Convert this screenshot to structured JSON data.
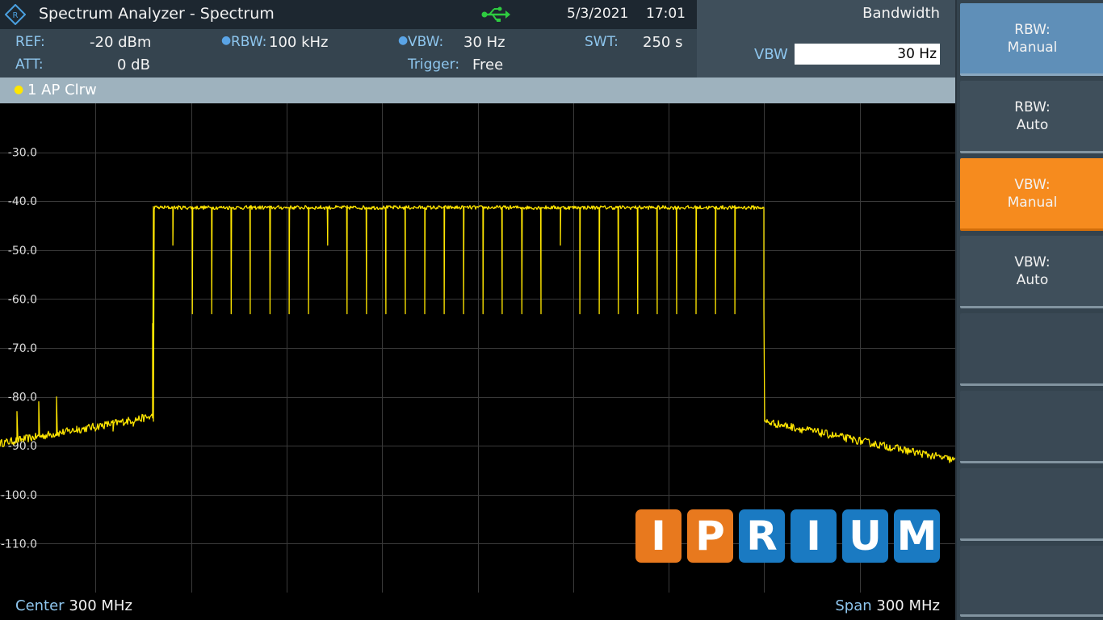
{
  "titlebar": {
    "title": "Spectrum Analyzer - Spectrum",
    "date": "5/3/2021",
    "time": "17:01"
  },
  "params": {
    "ref_label": "REF:",
    "ref_value": "-20 dBm",
    "att_label": "ATT:",
    "att_value": "0 dB",
    "rbw_label": "RBW:",
    "rbw_value": "100 kHz",
    "vbw_label": "VBW:",
    "vbw_value": "30 Hz",
    "trigger_label": "Trigger:",
    "trigger_value": "Free",
    "swt_label": "SWT:",
    "swt_value": "250 s"
  },
  "menu": {
    "title": "Bandwidth",
    "vbw_label": "VBW",
    "vbw_input": "30 Hz"
  },
  "trace": {
    "label": "1 AP  Clrw",
    "color": "#ffe600"
  },
  "footer": {
    "center_label": "Center",
    "center_value": "300 MHz",
    "span_label": "Span",
    "span_value": "300 MHz"
  },
  "softkeys": [
    {
      "line1": "RBW:",
      "line2": "Manual"
    },
    {
      "line1": "RBW:",
      "line2": "Auto"
    },
    {
      "line1": "VBW:",
      "line2": "Manual"
    },
    {
      "line1": "VBW:",
      "line2": "Auto"
    }
  ],
  "watermark": {
    "letters": [
      "I",
      "P",
      "R",
      "I",
      "U",
      "M"
    ],
    "colors": [
      "#e8791e",
      "#e8791e",
      "#1a7ac2",
      "#1a7ac2",
      "#1a7ac2",
      "#1a7ac2"
    ]
  },
  "chart_data": {
    "type": "line",
    "ylim": [
      -120,
      -20
    ],
    "y_ticks": [
      -30,
      -40,
      -50,
      -60,
      -70,
      -80,
      -90,
      -100,
      -110
    ],
    "y_tick_labels": [
      "-30.0",
      "-40.0",
      "-50.0",
      "-60.0",
      "-70.0",
      "-80.0",
      "-90.0",
      "-100.0",
      "-110.0"
    ],
    "xlim": [
      150,
      450
    ],
    "grid": true,
    "series": [
      {
        "color": "#ffe600",
        "noise_start": -89.5,
        "noise_end": -93,
        "band_start": 198,
        "band_end": 390,
        "plateau": -41.3,
        "shoulder_left": -84,
        "shoulder_right": -85,
        "notch_depth": -63,
        "notches_deep": [
          210.4,
          216.5,
          222.6,
          228.6,
          234.8,
          240.8,
          246.9,
          259.0,
          265.1,
          271.2,
          277.3,
          283.4,
          289.5,
          295.6,
          301.7,
          307.7,
          313.9,
          319.9,
          332.1,
          338.2,
          344.2,
          350.3,
          356.4,
          362.5,
          368.6,
          374.7,
          380.8
        ],
        "notches_shallow": [
          204.3,
          252.9,
          326.0
        ]
      }
    ]
  }
}
